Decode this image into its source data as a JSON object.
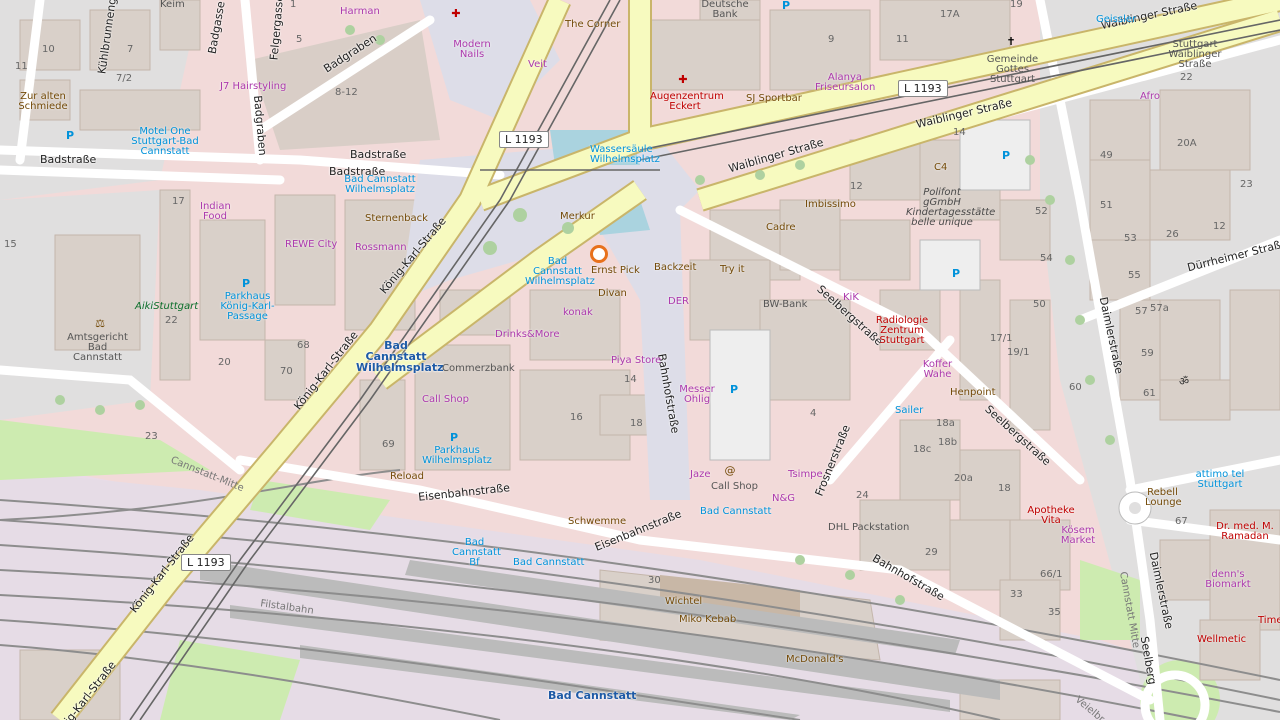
{
  "map": {
    "road_shields": [
      "L 1193",
      "L 1193",
      "L 1193"
    ],
    "streets": {
      "waiblinger_1": "Waiblinger Straße",
      "waiblinger_2": "Waiblinger Straße",
      "waiblinger_3": "Waiblinger Straße",
      "koenig_karl_1": "König-Karl-Straße",
      "koenig_karl_2": "König-Karl-Straße",
      "koenig_karl_3": "König-Karl-Straße",
      "koenig_karl_4": "König-Karl-Straße",
      "badstrasse_1": "Badstraße",
      "badstrasse_2": "Badstraße",
      "badstrasse_3": "Badstraße",
      "badgraben_1": "Badgraben",
      "badgraben_2": "Badgraben",
      "badgasse": "Badgasse",
      "felgergasse": "Felgergasse",
      "kuehlbrunnengasse": "Kühlbrunnengasse",
      "bahnhofstrasse_1": "Bahnhofstraße",
      "bahnhofstrasse_2": "Bahnhofstraße",
      "eisenbahnstrasse_1": "Eisenbahnstraße",
      "eisenbahnstrasse_2": "Eisenbahnstraße",
      "seelbergstrasse_1": "Seelbergstraße",
      "seelbergstrasse_2": "Seelbergstraße",
      "seelbergstrasse_3": "Seelberg",
      "daimlerstrasse_1": "Daimlerstraße",
      "daimlerstrasse_2": "Daimlerstraße",
      "duerrheimer": "Dürrheimer Straße",
      "frosnerstrasse": "Frosnerstraße",
      "filstalbahn": "Filstalbahn",
      "cannstatt_mitte_1": "Cannstatt-Mitte",
      "cannstatt_mitte_2": "Cannstatt Mitte",
      "veielbrunnen": "Veielbr"
    },
    "stations": {
      "wilhelmsplatz": "Bad Cannstatt Wilhelmsplatz",
      "bad_cannstatt": "Bad Cannstatt"
    },
    "pois": {
      "harman": "Harman",
      "keim": "Keim",
      "the_corner": "The Corner",
      "deutsche_bank": "Deutsche Bank",
      "geissler": "Geissler",
      "modern_nails": "Modern Nails",
      "veit": "Veit",
      "j7_hairstyling": "J7 Hairstyling",
      "zur_alten_schmiede": "Zur alten Schmiede",
      "motel_one": "Motel One Stuttgart-Bad Cannstatt",
      "augenzentrum": "Augenzentrum Eckert",
      "sj_sportbar": "SJ Sportbar",
      "alanya": "Alanya Friseursalon",
      "gemeinde": "Gemeinde Gottes Stuttgart",
      "stuttgart_waiblinger": "Stuttgart Waiblinger Straße",
      "afro": "Afro",
      "wassersaeule": "Wassersäule Wilhelmsplatz",
      "merkur": "Merkur",
      "c4": "C4",
      "polifont": "Polifont gGmbH Kindertagesstätte belle unique",
      "imbissimo": "Imbissimo",
      "cadre": "Cadre",
      "indian_food": "Indian Food",
      "bad_cannstatt_wilhelmsplatz_stop": "Bad Cannstatt Wilhelmsplatz",
      "sternenback": "Sternenback",
      "rossmann": "Rossmann",
      "rewe_city": "REWE City",
      "parkhaus_koenig": "Parkhaus König-Karl-Passage",
      "aikistuttgart": "AikiStuttgart",
      "amtsgericht": "Amtsgericht Bad Cannstatt",
      "bcw_stop2": "Bad Cannstatt Wilhelmsplatz",
      "ernst_pick": "Ernst Pick",
      "backzeit": "Backzeit",
      "try_it": "Try it",
      "divan": "Divan",
      "der": "DER",
      "konak": "konak",
      "drinks_more": "Drinks&More",
      "bw_bank": "BW-Bank",
      "kik": "KiK",
      "radiologie": "Radiologie Zentrum Stuttgart",
      "piya_store": "Piya Store",
      "commerzbank": "Commerzbank",
      "call_shop": "Call Shop",
      "parkhaus_wilhelmsplatz": "Parkhaus Wilhelmsplatz",
      "messer_ohlig": "Messer Ohlig",
      "koffer_wahe": "Koffer Wahe",
      "henpoint": "Henpoint",
      "sailer": "Sailer",
      "reload": "Reload",
      "tsimpe": "Tsimpe",
      "jaze": "Jaze",
      "call_shop_2": "Call Shop",
      "nandg": "N&G",
      "schwemme": "Schwemme",
      "bad_cannstatt_stop": "Bad Cannstatt",
      "dhl": "DHL Packstation",
      "apotheke_vita": "Apotheke Vita",
      "kosem_market": "Kösem Market",
      "attimo": "attimo tel Stuttgart",
      "rebell_lounge": "Rebell Lounge",
      "dr_ramadan": "Dr. med. M. Ramadan",
      "denns": "denn's Biomarkt",
      "wellmetic": "Wellmetic",
      "bad_cannstatt_bf": "Bad Cannstatt Bf",
      "bad_cannstatt_bus": "Bad Cannstatt",
      "wichtel": "Wichtel",
      "miko_kebab": "Miko Kebab",
      "mcdonalds": "McDonald's",
      "time": "Time"
    },
    "house_numbers": [
      "10",
      "7",
      "7/2",
      "11",
      "5",
      "1",
      "8-12",
      "17",
      "15",
      "22",
      "20",
      "68",
      "70",
      "69",
      "23",
      "16",
      "14",
      "18",
      "19",
      "17A",
      "11",
      "9",
      "14",
      "12",
      "52",
      "54",
      "50",
      "49",
      "51",
      "53",
      "55",
      "57",
      "57a",
      "59",
      "61",
      "60",
      "17/1",
      "19/1",
      "18a",
      "18b",
      "18c",
      "20a",
      "18",
      "4",
      "24",
      "29",
      "33",
      "35",
      "30",
      "66/1",
      "67",
      "20A",
      "22",
      "23",
      "12",
      "26"
    ],
    "colors": {
      "background": "#f2efe9",
      "residential": "#e0dfdf",
      "commercial": "#f2dad9",
      "retail": "#ffd6d1",
      "building": "#d9d0c9",
      "primary_road": "#fcd6a4",
      "secondary_road": "#f7fabf",
      "pedestrian": "#dddde8",
      "rail_area": "#ebdbe8",
      "grass": "#cdebb0",
      "water": "#aad3df",
      "marker": "#e8711c"
    }
  }
}
